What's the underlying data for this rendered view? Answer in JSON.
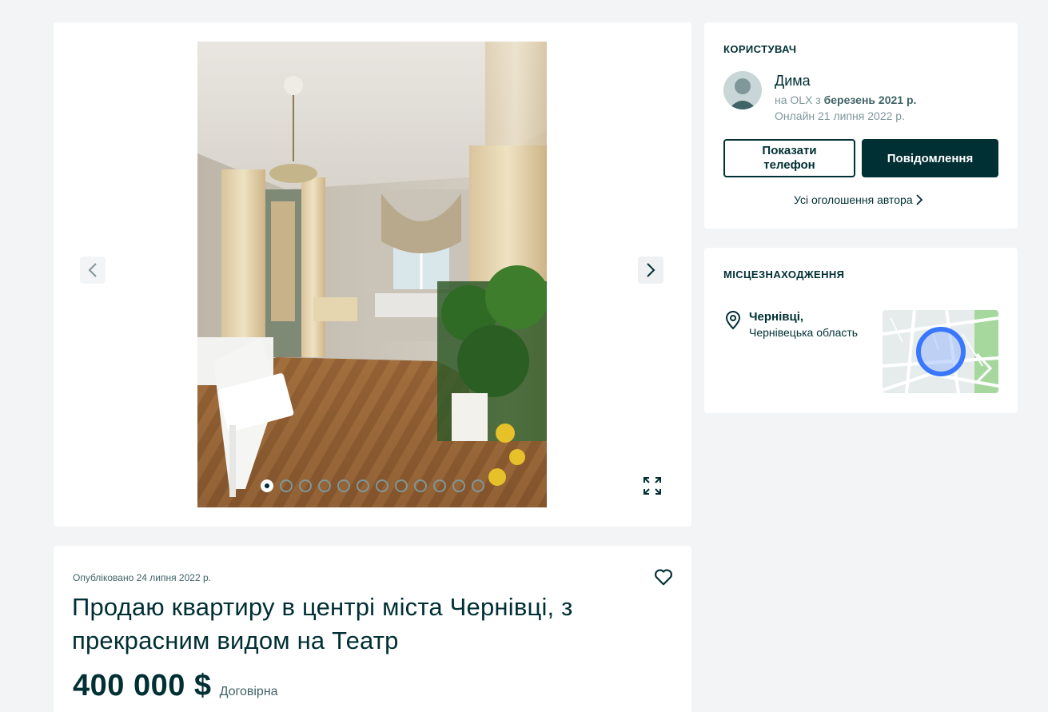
{
  "gallery": {
    "photo_alt": "Фото квартири",
    "total_photos": 12,
    "active_photo_index": 0
  },
  "details": {
    "published": "Опубліковано 24 липня 2022 р.",
    "title": "Продаю квартиру в центрі міста Чернівці, з прекрасним видом на Театр",
    "price": "400 000 $",
    "negotiable": "Договірна"
  },
  "user": {
    "section_title": "КОРИСТУВАЧ",
    "name": "Дима",
    "since_prefix": "на OLX з ",
    "since_date": "березень 2021 р.",
    "online": "Онлайн 21 липня 2022 р.",
    "phone_button": "Показати телефон",
    "message_button": "Повідомлення",
    "all_ads_link": "Усі оголошення автора"
  },
  "location": {
    "section_title": "МІСЦЕЗНАХОДЖЕННЯ",
    "city": "Чернівці,",
    "region": "Чернівецька область"
  },
  "colors": {
    "primary": "#002f34",
    "background": "#f2f4f5",
    "map_marker": "#3a77ff"
  },
  "icons": [
    "chevron-left-icon",
    "chevron-right-icon",
    "fullscreen-icon",
    "heart-icon",
    "location-pin-icon"
  ]
}
